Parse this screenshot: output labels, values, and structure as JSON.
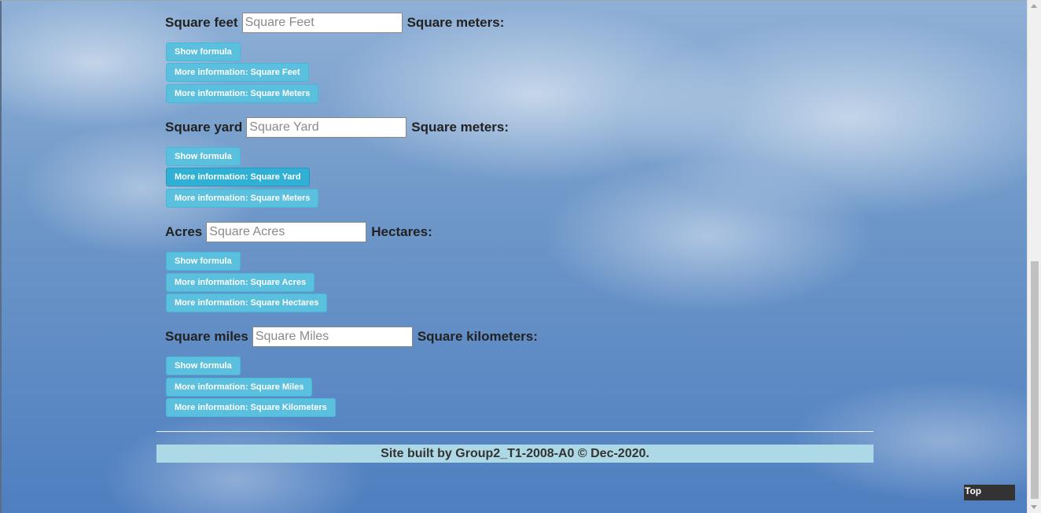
{
  "converters": [
    {
      "input_label": "Square feet",
      "input_placeholder": "Square Feet",
      "output_label": "Square meters:",
      "buttons": [
        "Show formula",
        "More information: Square Feet",
        "More information: Square Meters"
      ]
    },
    {
      "input_label": "Square yard",
      "input_placeholder": "Square Yard",
      "output_label": "Square meters:",
      "buttons": [
        "Show formula",
        "More information: Square Yard",
        "More information: Square Meters"
      ]
    },
    {
      "input_label": "Acres",
      "input_placeholder": "Square Acres",
      "output_label": "Hectares:",
      "buttons": [
        "Show formula",
        "More information: Square Acres",
        "More information: Square Hectares"
      ]
    },
    {
      "input_label": "Square miles",
      "input_placeholder": "Square Miles",
      "output_label": "Square kilometers:",
      "buttons": [
        "Show formula",
        "More information: Square Miles",
        "More information: Square Kilometers"
      ]
    }
  ],
  "footer": {
    "text": "Site built by Group2_T1-2008-A0 © Dec-2020."
  },
  "top_link": {
    "label": "Top"
  },
  "colors": {
    "button": "#5bc0de",
    "footer_bg": "#add8e6",
    "top_bg": "#333333"
  }
}
